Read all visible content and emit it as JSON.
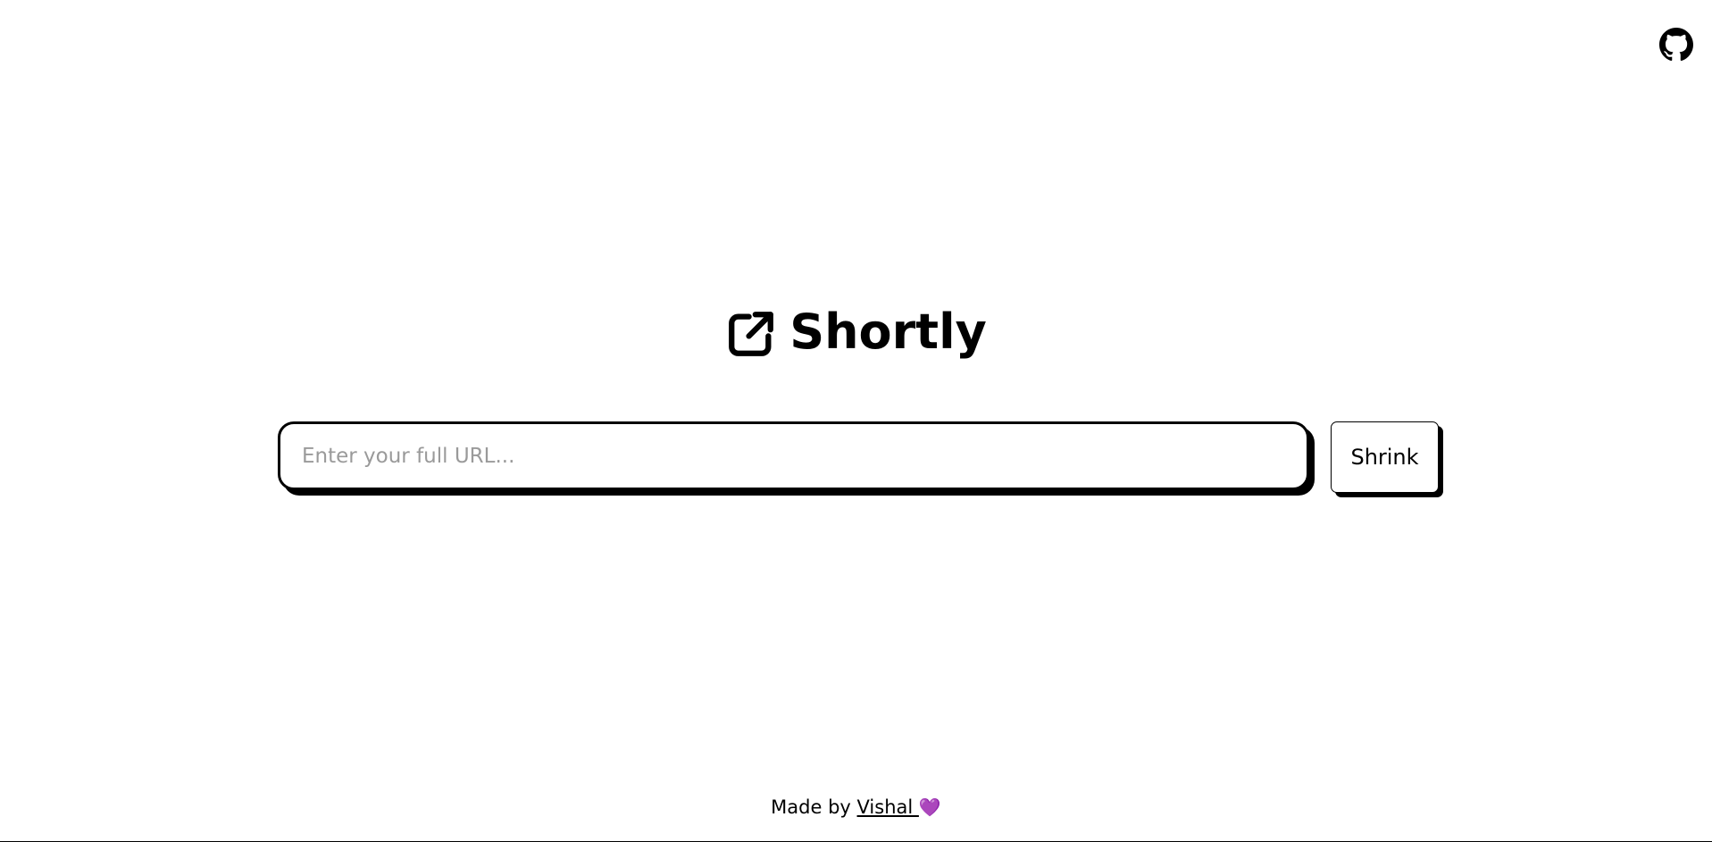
{
  "header": {
    "github_icon": "github-icon"
  },
  "brand": {
    "icon": "external-link-icon",
    "title": "Shortly"
  },
  "form": {
    "url_placeholder": "Enter your full URL...",
    "url_value": "",
    "submit_label": "Shrink"
  },
  "footer": {
    "prefix": "Made by ",
    "author": "Vishal ",
    "heart": "💜"
  },
  "colors": {
    "background": "#ffffff",
    "foreground": "#000000",
    "placeholder": "#9a9a9a",
    "heart": "#3a2a4a"
  }
}
